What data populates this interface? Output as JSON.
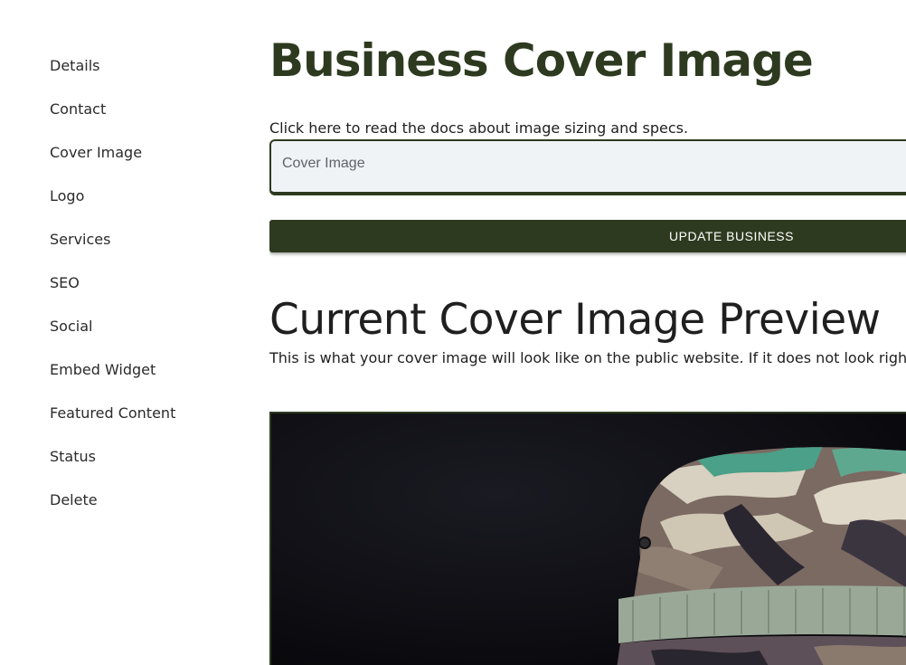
{
  "sidebar": {
    "items": [
      {
        "label": "Details"
      },
      {
        "label": "Contact"
      },
      {
        "label": "Cover Image"
      },
      {
        "label": "Logo"
      },
      {
        "label": "Services"
      },
      {
        "label": "SEO"
      },
      {
        "label": "Social"
      },
      {
        "label": "Embed Widget"
      },
      {
        "label": "Featured Content"
      },
      {
        "label": "Status"
      },
      {
        "label": "Delete"
      }
    ]
  },
  "main": {
    "title": "Business Cover Image",
    "docs_link": "Click here to read the docs about image sizing and specs.",
    "cover_field": {
      "placeholder": "Cover Image",
      "value": ""
    },
    "update_button": "UPDATE BUSINESS",
    "preview_title": "Current Cover Image Preview",
    "preview_description": "This is what your cover image will look like on the public website. If it does not look right, uplo"
  },
  "colors": {
    "accent": "#2d3a1f",
    "field_background": "#f0f3f6",
    "preview_background": "#0b0b0f"
  },
  "icons": {
    "preview_image": "camo-bucket-hat-image"
  }
}
